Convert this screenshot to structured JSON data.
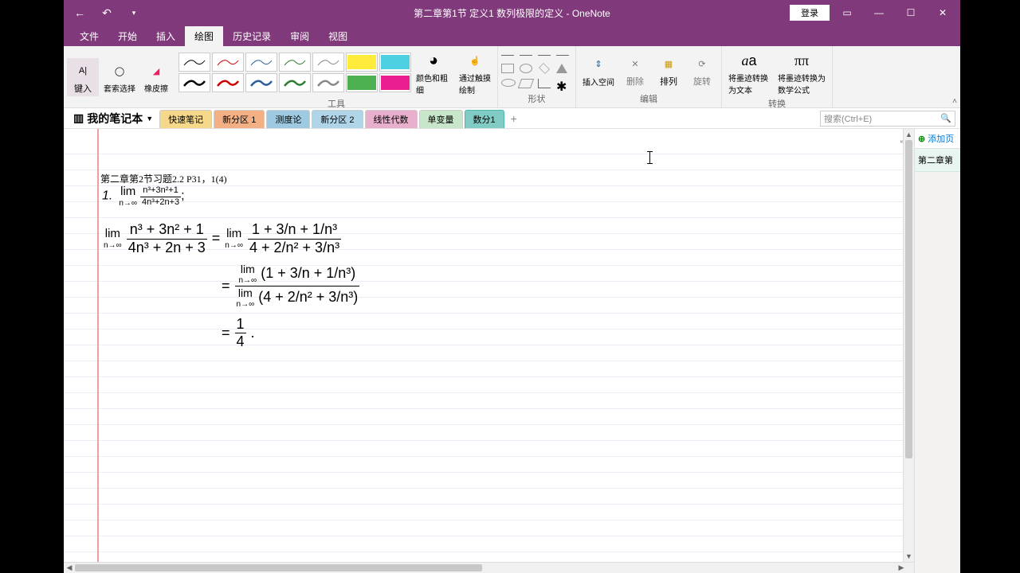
{
  "titlebar": {
    "title": "第二章第1节 定义1 数列极限的定义  -  OneNote",
    "login": "登录"
  },
  "tabs": {
    "items": [
      "文件",
      "开始",
      "插入",
      "绘图",
      "历史记录",
      "审阅",
      "视图"
    ],
    "active_index": 3
  },
  "ribbon": {
    "type_input": "键入",
    "lasso": "套索选择",
    "eraser": "橡皮擦",
    "tools_label": "工具",
    "color_thickness": "颜色和粗细",
    "touch_draw": "通过触摸绘制",
    "shapes_label": "形状",
    "insert_space": "插入空间",
    "delete": "删除",
    "arrange": "排列",
    "rotate": "旋转",
    "edit_label": "编辑",
    "ink_to_text": "将墨迹转换为文本",
    "ink_to_math": "将墨迹转换为数学公式",
    "convert_label": "转换"
  },
  "notebook": {
    "title": "我的笔记本",
    "sections": [
      "快速笔记",
      "新分区 1",
      "测度论",
      "新分区 2",
      "线性代数",
      "单变量",
      "数分1"
    ],
    "search_placeholder": "搜索(Ctrl+E)"
  },
  "page_panel": {
    "add_page": "添加页",
    "pages": [
      "第二章第"
    ]
  },
  "page_content": {
    "heading": "第二章第2节习题2.2 P31，1(4)",
    "item_num": "1.",
    "eq_inline": {
      "lim": "lim",
      "sub": "n→∞",
      "num": "n³+3n²+1",
      "den": "4n³+2n+3",
      "tail": ";"
    },
    "derivation": {
      "line1_left_num": "n³ + 3n² + 1",
      "line1_left_den": "4n³ + 2n + 3",
      "line1_right_num": "1 + 3/n + 1/n³",
      "line1_right_den": "4 + 2/n² + 3/n³",
      "line2_num": "(1 + 3/n + 1/n³)",
      "line2_den": "(4 + 2/n² + 3/n³)",
      "result_num": "1",
      "result_den": "4",
      "lim": "lim",
      "sub": "n→∞",
      "eq": "="
    }
  }
}
